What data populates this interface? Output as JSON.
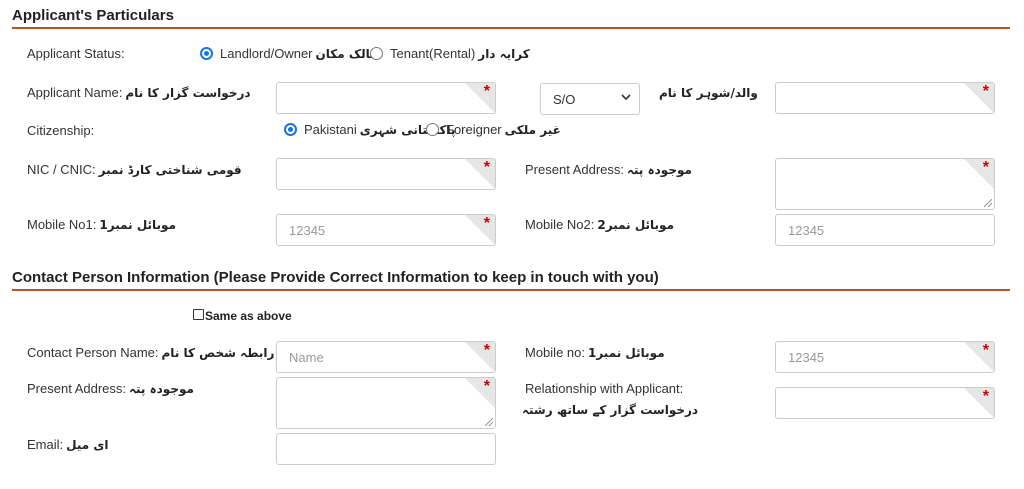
{
  "applicant": {
    "title": "Applicant's Particulars",
    "status_label": "Applicant Status:",
    "status_options": [
      {
        "label": "Landlord/Owner",
        "urdu": "مالک مکان",
        "selected": true
      },
      {
        "label": "Tenant(Rental)",
        "urdu": "کرایہ دار",
        "selected": false
      }
    ],
    "name_label": "Applicant Name:",
    "name_urdu": "درخواست گزار کا نام",
    "relation_select_value": "S/O",
    "father_urdu": "والد/شوہر کا نام",
    "citizenship_label": "Citizenship:",
    "citizenship_options": [
      {
        "label": "Pakistani",
        "urdu": "پاکستانی شہری",
        "selected": true
      },
      {
        "label": "Foreigner",
        "urdu": "غیر ملکی",
        "selected": false
      }
    ],
    "nic_label": "NIC / CNIC:",
    "nic_urdu": "قومی شناختی کارڈ نمبر",
    "present_address_label": "Present Address:",
    "present_address_urdu": "موجودہ پتہ",
    "mobile1_label": "Mobile No1:",
    "mobile1_urdu": "موبائل نمبر1",
    "mobile1_placeholder": "12345",
    "mobile2_label": "Mobile No2:",
    "mobile2_urdu": "موبائل نمبر2",
    "mobile2_placeholder": "12345"
  },
  "contact": {
    "title": "Contact Person Information (Please Provide Correct Information to keep in touch with you)",
    "same_as_above_label": "Same as above",
    "name_label": "Contact Person Name:",
    "name_urdu": "رابطہ شخص کا نام",
    "name_placeholder": "Name",
    "mobile_label": "Mobile no:",
    "mobile_urdu": "موبائل نمبر1",
    "mobile_placeholder": "12345",
    "address_label": "Present Address:",
    "address_urdu": "موجودہ پتہ",
    "relationship_label": "Relationship with Applicant:",
    "relationship_urdu": "درخواست گزار کے ساتھ رشتہ",
    "email_label": "Email:",
    "email_urdu": "ای میل"
  },
  "required_marker": "*",
  "colors": {
    "section_rule": "#c0502a",
    "required_star": "#cc0000",
    "radio_accent": "#1a73e8"
  }
}
